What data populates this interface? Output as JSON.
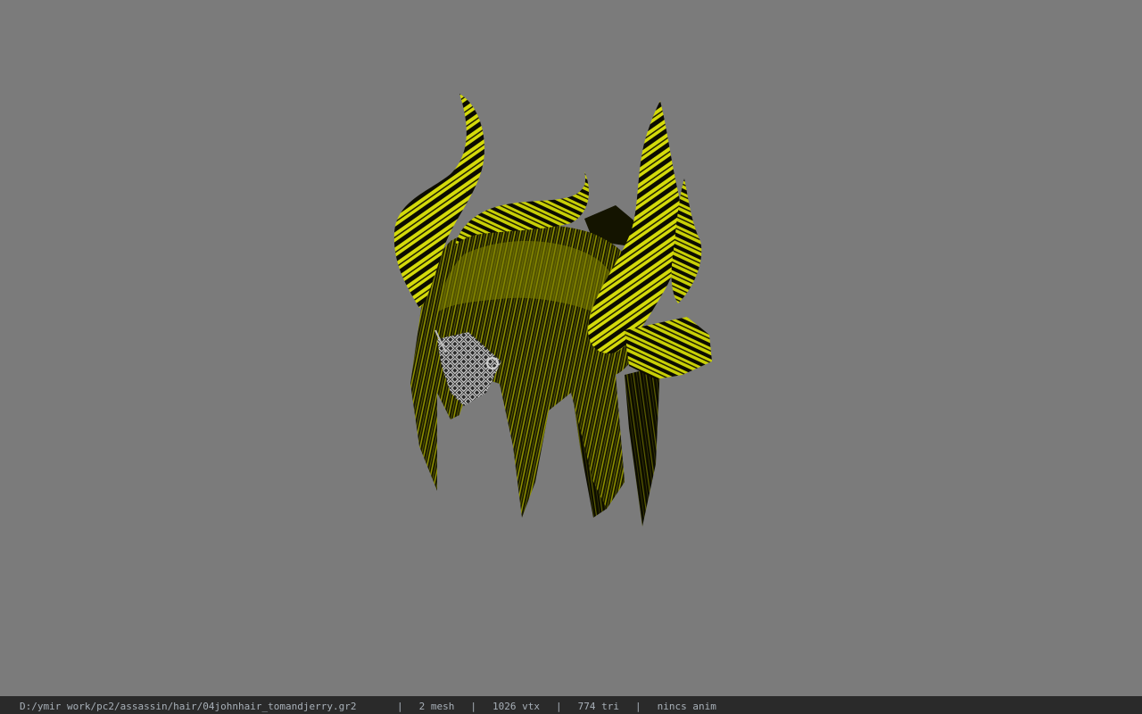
{
  "viewer": {
    "background_color": "#7b7b7b",
    "model_subject": "horned-hair-model",
    "texture_colors": {
      "hair_yellow": "#b5b800",
      "horn_yellow": "#d6dc08",
      "stripe_black": "#0a0a00",
      "mesh_silver": "#c8c8c8"
    }
  },
  "status_bar": {
    "file_path": "D:/ymir work/pc2/assassin/hair/04johnhair_tomandjerry.gr2",
    "separator": "|",
    "mesh_count": "2 mesh",
    "vertex_count": "1026 vtx",
    "triangle_count": "774 tri",
    "anim_info": "nincs anim"
  }
}
